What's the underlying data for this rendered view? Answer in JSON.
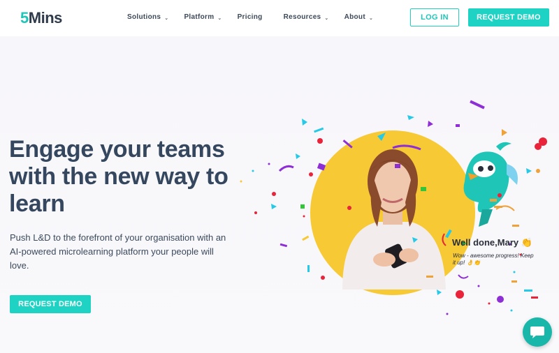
{
  "brand": {
    "logo_number": "5",
    "logo_text": "Mins"
  },
  "nav": {
    "items": [
      {
        "label": "Solutions",
        "has_dropdown": true
      },
      {
        "label": "Platform",
        "has_dropdown": true
      },
      {
        "label": "Pricing",
        "has_dropdown": false
      },
      {
        "label": "Resources",
        "has_dropdown": true
      },
      {
        "label": "About",
        "has_dropdown": true
      }
    ],
    "chevron_icon": "chevron-down-icon"
  },
  "header_actions": {
    "login_label": "LOG IN",
    "demo_label": "REQUEST DEMO"
  },
  "hero": {
    "title": "Engage your teams with the new way to learn",
    "subtitle": "Push L&D to the forefront of your organisation with an AI-powered microlearning platform your people will love.",
    "cta_label": "REQUEST DEMO"
  },
  "celebration": {
    "title": "Well done,Mary 👏",
    "message": "Wow - awesome progress! Keep it up! 👌👏"
  },
  "colors": {
    "accent": "#1ed3c3",
    "heading": "#35475e",
    "circle": "#f7c935",
    "chat": "#18b7a9"
  },
  "icons": {
    "chat": "chat-bubble-icon",
    "mascot": "parrot-mascot-icon"
  }
}
